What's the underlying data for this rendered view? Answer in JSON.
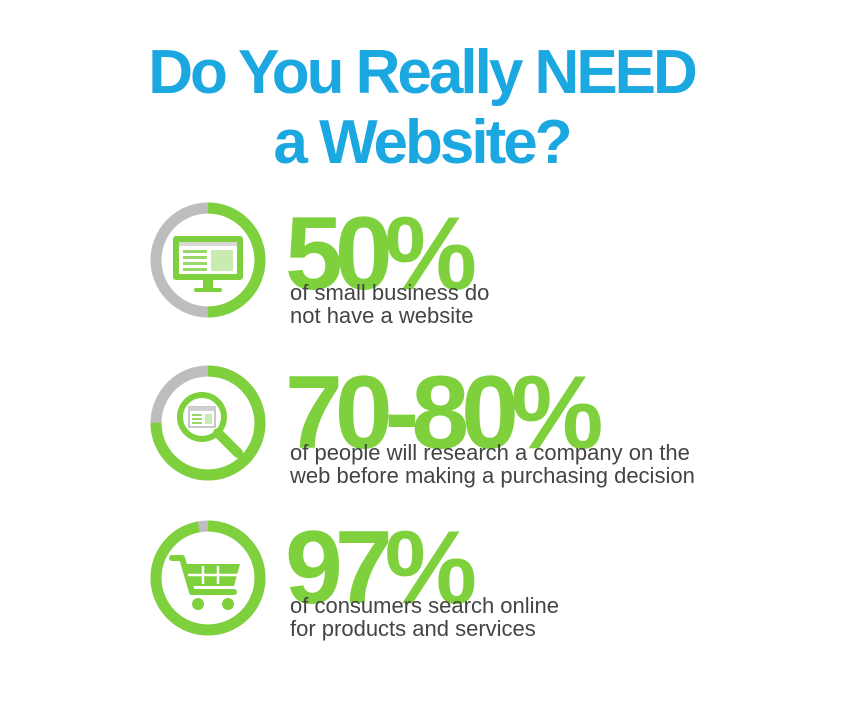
{
  "title": {
    "line1": "Do You Really NEED",
    "line2": "a Website?",
    "color": "#1ba7e0"
  },
  "accent_color": "#7ed13d",
  "ring_gray": "#bdbdbd",
  "text_color": "#444444",
  "stats": [
    {
      "value": "50%",
      "line1": "of small business do",
      "line2": "not have a website",
      "icon": "monitor-icon",
      "fill_fraction": 0.5
    },
    {
      "value": "70-80%",
      "line1": "of people will research a company on the",
      "line2": "web before making a purchasing decision",
      "icon": "magnifier-icon",
      "fill_fraction": 0.75
    },
    {
      "value": "97%",
      "line1": "of consumers search online",
      "line2": "for products and services",
      "icon": "shopping-cart-icon",
      "fill_fraction": 0.97
    }
  ]
}
